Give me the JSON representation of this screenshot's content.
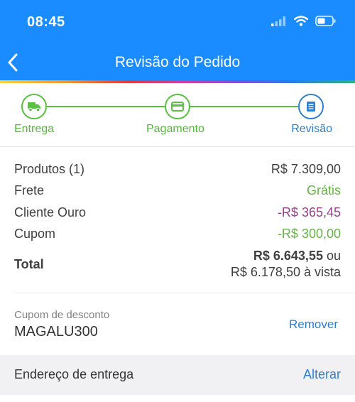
{
  "status_bar": {
    "time": "08:45"
  },
  "header": {
    "title": "Revisão do Pedido"
  },
  "steps": [
    {
      "label": "Entrega",
      "state": "done",
      "icon": "truck-icon"
    },
    {
      "label": "Pagamento",
      "state": "done",
      "icon": "credit-card-icon"
    },
    {
      "label": "Revisão",
      "state": "active",
      "icon": "document-icon"
    }
  ],
  "summary": {
    "products_label": "Produtos (1)",
    "products_value": "R$ 7.309,00",
    "shipping_label": "Frete",
    "shipping_value": "Grátis",
    "gold_label": "Cliente Ouro",
    "gold_value": "-R$ 365,45",
    "coupon_label": "Cupom",
    "coupon_value": "-R$ 300,00",
    "total_label": "Total",
    "total_value": "R$ 6.643,55",
    "total_or": "ou",
    "total_cash": "R$ 6.178,50 à vista"
  },
  "coupon": {
    "caption": "Cupom de desconto",
    "code": "MAGALU300",
    "remove_label": "Remover"
  },
  "address": {
    "label": "Endereço de entrega",
    "change_label": "Alterar"
  },
  "colors": {
    "header_blue": "#1a8cff",
    "success_green": "#56c23d",
    "link_blue": "#2d7fd3",
    "gold_purple": "#9b3d8e"
  }
}
